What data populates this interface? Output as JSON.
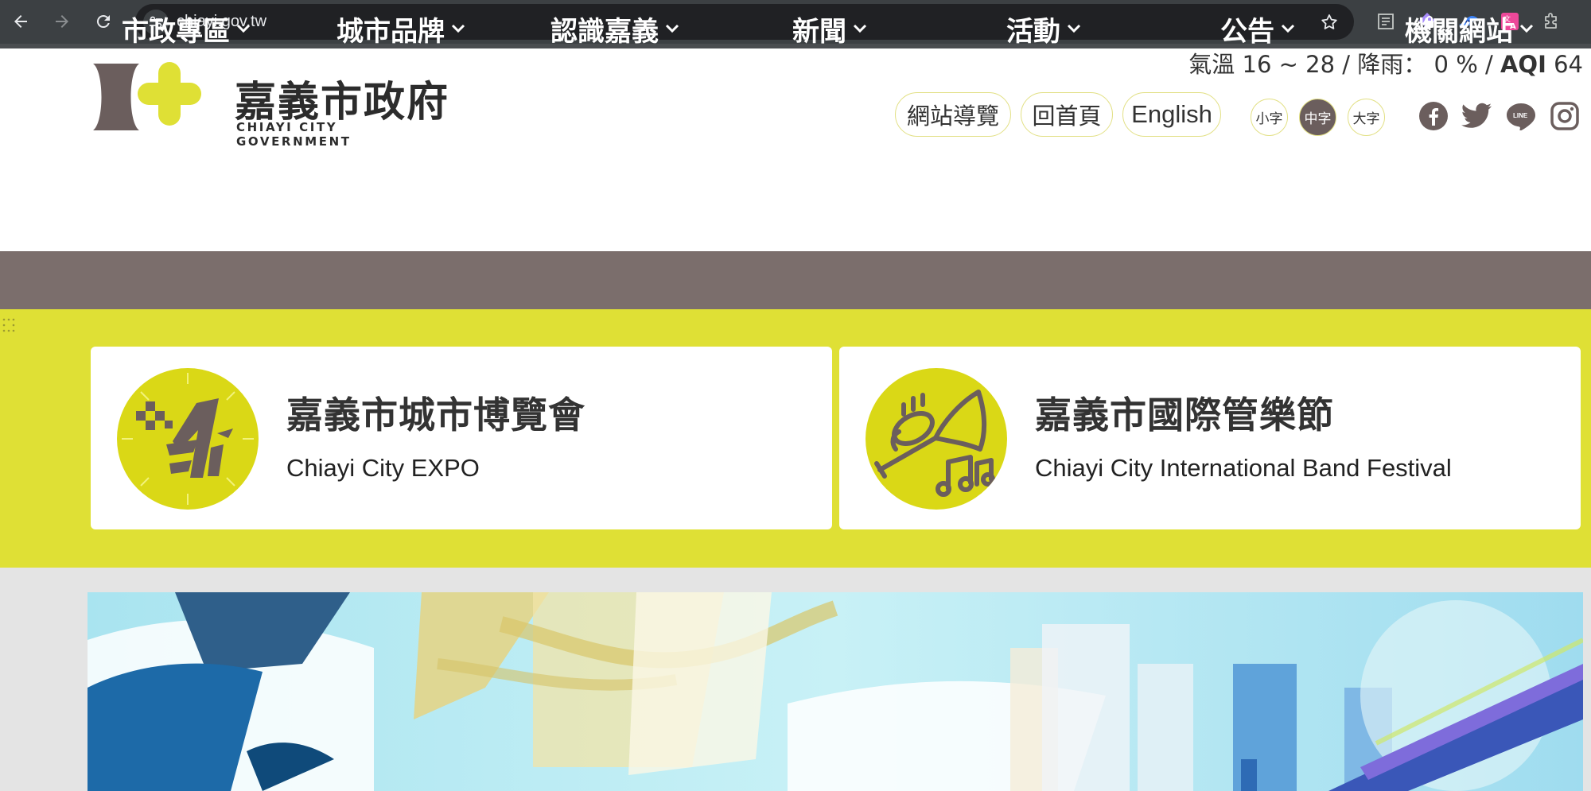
{
  "browser": {
    "url": "chiayi.gov.tw"
  },
  "header": {
    "logo_title": "嘉義市政府",
    "logo_subtitle": "CHIAYI CITY GOVERNMENT",
    "weather": {
      "temp_label": "氣溫",
      "temp_value": "16 ~ 28",
      "sep1": "/",
      "rain_label": "降雨：",
      "rain_value": "0 %",
      "sep2": "/",
      "aqi_label": "AQI",
      "aqi_value": "64"
    },
    "links": {
      "sitemap": "網站導覽",
      "home": "回首頁",
      "english": "English"
    },
    "font_size": {
      "small": "小字",
      "medium": "中字",
      "large": "大字",
      "active": "medium"
    },
    "social": [
      "facebook-icon",
      "twitter-icon",
      "line-icon",
      "instagram-icon"
    ]
  },
  "nav": {
    "items": [
      {
        "label": "市政專區"
      },
      {
        "label": "城市品牌"
      },
      {
        "label": "認識嘉義"
      },
      {
        "label": "新聞"
      },
      {
        "label": "活動"
      },
      {
        "label": "公告"
      },
      {
        "label": "機關網站"
      }
    ]
  },
  "cards": [
    {
      "title": "嘉義市城市博覽會",
      "subtitle": "Chiayi City EXPO",
      "icon": "expo-icon"
    },
    {
      "title": "嘉義市國際管樂節",
      "subtitle": "Chiayi City International Band Festival",
      "icon": "trumpet-icon"
    }
  ],
  "colors": {
    "brand_yellow": "#dfe035",
    "nav_brown": "#7b6e6c",
    "icon_yellow": "#dad816",
    "icon_brown": "#6b5e5d"
  }
}
